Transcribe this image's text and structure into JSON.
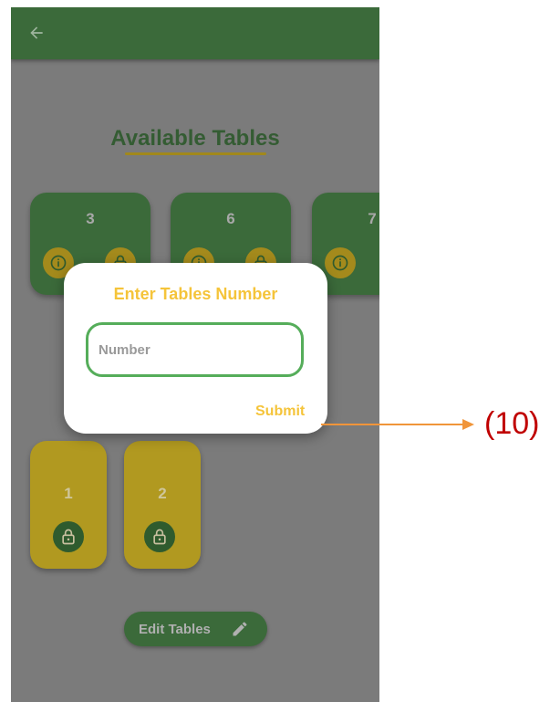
{
  "app_bar": {
    "back_icon": "arrow-left-icon"
  },
  "section": {
    "title": "Available Tables"
  },
  "occupied_tables": [
    {
      "number": "3"
    },
    {
      "number": "6"
    },
    {
      "number": "7"
    }
  ],
  "free_tables": [
    {
      "number": "1"
    },
    {
      "number": "2"
    }
  ],
  "edit_button": {
    "label": "Edit Tables",
    "icon": "pencil-icon"
  },
  "dialog": {
    "title": "Enter Tables Number",
    "input": {
      "placeholder": "Number",
      "value": ""
    },
    "submit_label": "Submit"
  },
  "annotation": {
    "label": "(10)"
  },
  "colors": {
    "app_bar": "#3b6a3a",
    "accent_yellow": "#f5c43a",
    "input_border": "#55ad5a",
    "annotation_arrow": "#f0953a",
    "annotation_text": "#c00000"
  }
}
